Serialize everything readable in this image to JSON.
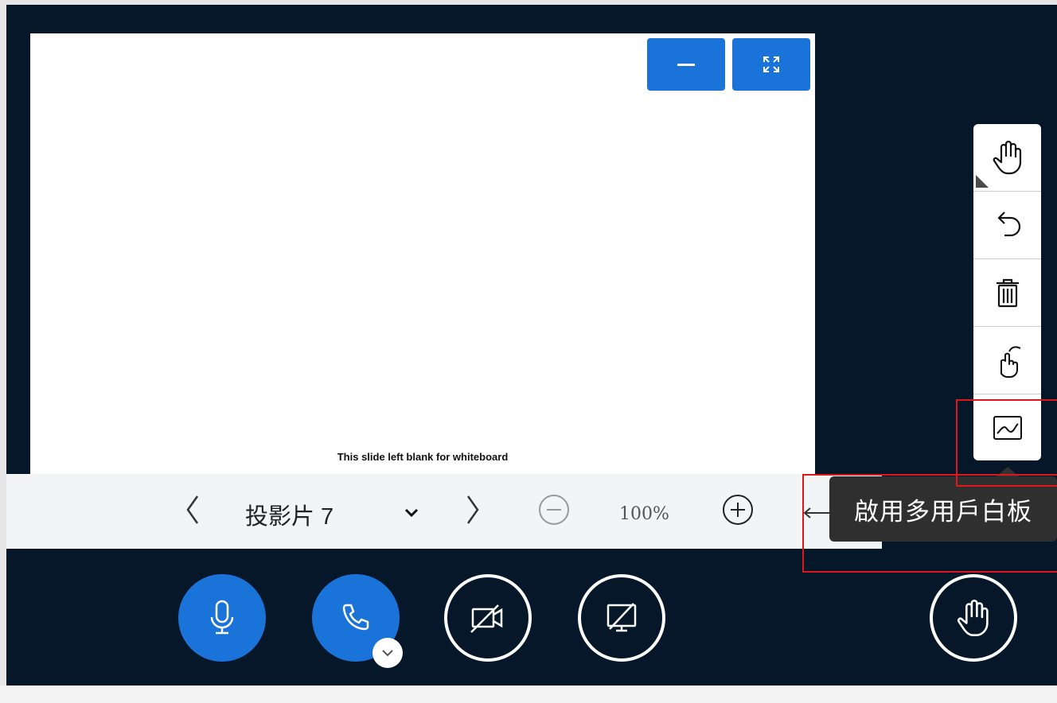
{
  "slide": {
    "caption": "This slide left blank for whiteboard",
    "minimize_icon": "minus-icon",
    "fullscreen_icon": "fullscreen-icon"
  },
  "presentation_toolbar": {
    "prev_icon": "chevron-left-icon",
    "slide_label": "投影片",
    "slide_number": "7",
    "dropdown_icon": "chevron-down-icon",
    "next_icon": "chevron-right-icon",
    "zoom_out_icon": "zoom-out-icon",
    "zoom_value": "100%",
    "zoom_in_icon": "zoom-in-icon"
  },
  "whiteboard_toolbar": {
    "items": [
      {
        "icon": "hand-pan-icon"
      },
      {
        "icon": "undo-icon"
      },
      {
        "icon": "trash-icon"
      },
      {
        "icon": "pointer-hand-icon"
      },
      {
        "icon": "multi-user-whiteboard-icon"
      }
    ]
  },
  "tooltip": {
    "text": "啟用多用戶白板"
  },
  "actions": {
    "mic_icon": "microphone-icon",
    "phone_icon": "phone-icon",
    "camera_icon": "camera-off-icon",
    "screen_icon": "screen-share-off-icon",
    "raise_hand_icon": "raise-hand-icon"
  },
  "colors": {
    "app_background": "#06172a",
    "accent": "#1a73d9",
    "highlight": "#e0161b",
    "tooltip_bg": "#2f2f2f"
  }
}
